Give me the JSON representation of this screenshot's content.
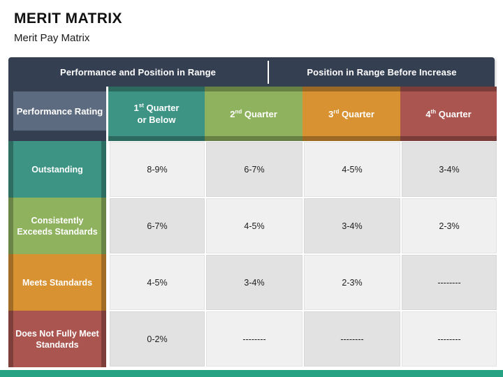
{
  "title": "MERIT MATRIX",
  "subtitle": "Merit Pay Matrix",
  "banner": {
    "left_label": "Performance and Position in Range",
    "right_label": "Position in Range Before Increase"
  },
  "colors": {
    "banner_bg": "#343f52",
    "corner_panel": "#5d6b80",
    "teal": "#3d9485",
    "green": "#8fb25e",
    "orange": "#d99232",
    "red": "#ab5550",
    "bottom_bar": "#27a383",
    "cell_light": "#f0f0f0",
    "cell_dark": "#e2e2e2"
  },
  "table": {
    "corner_header": "Performance Rating",
    "column_headers": [
      {
        "num": "1",
        "ord": "st",
        "rest": "Quarter",
        "second_line": "or Below",
        "color": "#3d9485"
      },
      {
        "num": "2",
        "ord": "nd",
        "rest": "Quarter",
        "second_line": "",
        "color": "#8fb25e"
      },
      {
        "num": "3",
        "ord": "rd",
        "rest": "Quarter",
        "second_line": "",
        "color": "#d99232"
      },
      {
        "num": "4",
        "ord": "th",
        "rest": "Quarter",
        "second_line": "",
        "color": "#ab5550"
      }
    ],
    "rows": [
      {
        "label": "Outstanding",
        "color": "#3d9485",
        "values": [
          "8-9%",
          "6-7%",
          "4-5%",
          "3-4%"
        ]
      },
      {
        "label": "Consistently Exceeds Standards",
        "color": "#8fb25e",
        "values": [
          "6-7%",
          "4-5%",
          "3-4%",
          "2-3%"
        ]
      },
      {
        "label": "Meets Standards",
        "color": "#d99232",
        "values": [
          "4-5%",
          "3-4%",
          "2-3%",
          "--------"
        ]
      },
      {
        "label": "Does Not Fully Meet Standards",
        "color": "#ab5550",
        "values": [
          "0-2%",
          "--------",
          "--------",
          "--------"
        ]
      }
    ]
  }
}
